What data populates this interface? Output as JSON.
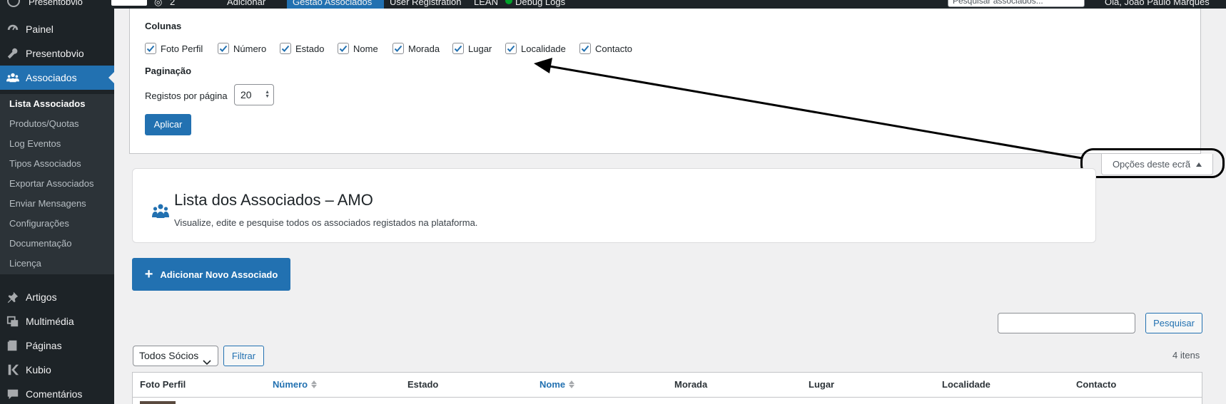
{
  "admin_bar": {
    "site_name": "Presentobvio",
    "comments_count": "2",
    "new_label": "Adicionar",
    "active_item": "Gestão Associados",
    "user_reg": "User Registration",
    "leaf": "LEAN",
    "debug": "Debug Logs",
    "search_placeholder": "Pesquisar associados...",
    "greeting": "Olá, João Paulo Marques"
  },
  "menu": {
    "items": [
      {
        "label": "Painel",
        "icon": "dashboard-icon"
      },
      {
        "label": "Presentobvio",
        "icon": "wrench-icon"
      },
      {
        "label": "Associados",
        "icon": "groups-icon"
      },
      {
        "label": "Artigos",
        "icon": "pushpin-icon"
      },
      {
        "label": "Multimédia",
        "icon": "media-icon"
      },
      {
        "label": "Páginas",
        "icon": "page-icon"
      },
      {
        "label": "Kubio",
        "icon": "kubio-icon"
      },
      {
        "label": "Comentários",
        "icon": "comment-icon"
      }
    ],
    "submenu": [
      "Lista Associados",
      "Produtos/Quotas",
      "Log Eventos",
      "Tipos Associados",
      "Exportar Associados",
      "Enviar Mensagens",
      "Configurações",
      "Documentação",
      "Licença"
    ]
  },
  "screen_options": {
    "columns_heading": "Colunas",
    "columns": [
      "Foto Perfil",
      "Número",
      "Estado",
      "Nome",
      "Morada",
      "Lugar",
      "Localidade",
      "Contacto"
    ],
    "pagination_heading": "Paginação",
    "per_page_label": "Registos por página",
    "per_page_value": "20",
    "apply_label": "Aplicar",
    "tab_label": "Opções deste ecrã"
  },
  "header": {
    "title": "Lista dos Associados – AMO",
    "subtitle": "Visualize, edite e pesquise todos os associados registados na plataforma."
  },
  "add_button": "Adicionar Novo Associado",
  "search": {
    "button": "Pesquisar"
  },
  "filter": {
    "selected": "Todos Sócios",
    "button": "Filtrar"
  },
  "items_count": "4 itens",
  "table": {
    "columns": [
      {
        "label": "Foto Perfil",
        "sortable": false
      },
      {
        "label": "Número",
        "sortable": true
      },
      {
        "label": "Estado",
        "sortable": false
      },
      {
        "label": "Nome",
        "sortable": true
      },
      {
        "label": "Morada",
        "sortable": false
      },
      {
        "label": "Lugar",
        "sortable": false
      },
      {
        "label": "Localidade",
        "sortable": false
      },
      {
        "label": "Contacto",
        "sortable": false
      }
    ]
  },
  "colors": {
    "accent": "#2271b1",
    "menu_bg": "#1d2327",
    "submenu_bg": "#2c3338"
  }
}
